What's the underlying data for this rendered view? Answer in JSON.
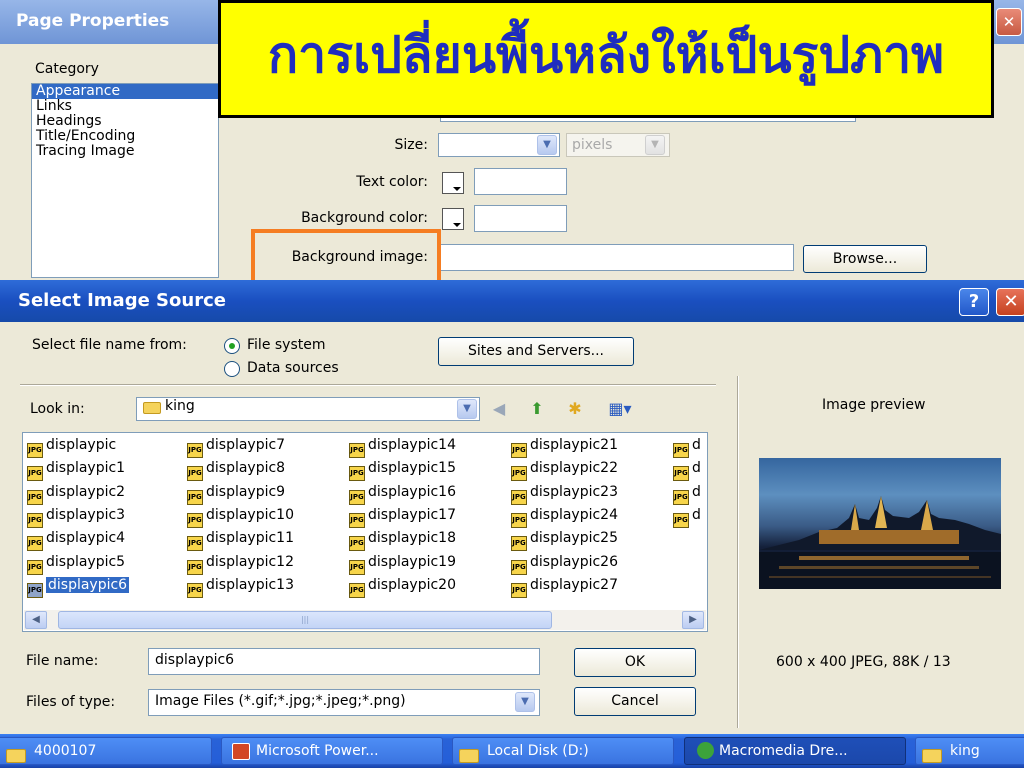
{
  "banner": {
    "text": "การเปลี่ยนพื้นหลังให้เป็นรูปภาพ"
  },
  "page_properties": {
    "title": "Page Properties",
    "category_label": "Category",
    "categories": [
      "Appearance",
      "Links",
      "Headings",
      "Title/Encoding",
      "Tracing Image"
    ],
    "selected_category": "Appearance",
    "size_label": "Size:",
    "size_unit": "pixels",
    "text_color_label": "Text color:",
    "background_color_label": "Background color:",
    "background_image_label": "Background image:",
    "browse_label": "Browse..."
  },
  "select_image_source": {
    "title": "Select Image Source",
    "help_label": "?",
    "close_label": "✕",
    "select_from_label": "Select file name from:",
    "file_system_label": "File system",
    "data_sources_label": "Data sources",
    "sites_servers_label": "Sites and Servers...",
    "look_in_label": "Look in:",
    "look_in_value": "king",
    "files": [
      "displaypic",
      "displaypic1",
      "displaypic2",
      "displaypic3",
      "displaypic4",
      "displaypic5",
      "displaypic6",
      "displaypic7",
      "displaypic8",
      "displaypic9",
      "displaypic10",
      "displaypic11",
      "displaypic12",
      "displaypic13",
      "displaypic14",
      "displaypic15",
      "displaypic16",
      "displaypic17",
      "displaypic18",
      "displaypic19",
      "displaypic20",
      "displaypic21",
      "displaypic22",
      "displaypic23",
      "displaypic24",
      "displaypic25",
      "displaypic26",
      "displaypic27",
      "d",
      "d",
      "d",
      "d"
    ],
    "selected_file": "displaypic6",
    "file_icon_label": "JPG",
    "file_name_label": "File name:",
    "file_name_value": "displaypic6",
    "files_of_type_label": "Files of type:",
    "files_of_type_value": "Image Files (*.gif;*.jpg;*.jpeg;*.png)",
    "ok_label": "OK",
    "cancel_label": "Cancel",
    "preview_label": "Image preview",
    "preview_info": "600 x 400 JPEG, 88K / 13"
  },
  "taskbar": {
    "items": [
      {
        "label": "4000107"
      },
      {
        "label": "Microsoft Power..."
      },
      {
        "label": "Local Disk (D:)"
      },
      {
        "label": "Macromedia Dre..."
      },
      {
        "label": "king"
      }
    ],
    "active_index": 3
  }
}
